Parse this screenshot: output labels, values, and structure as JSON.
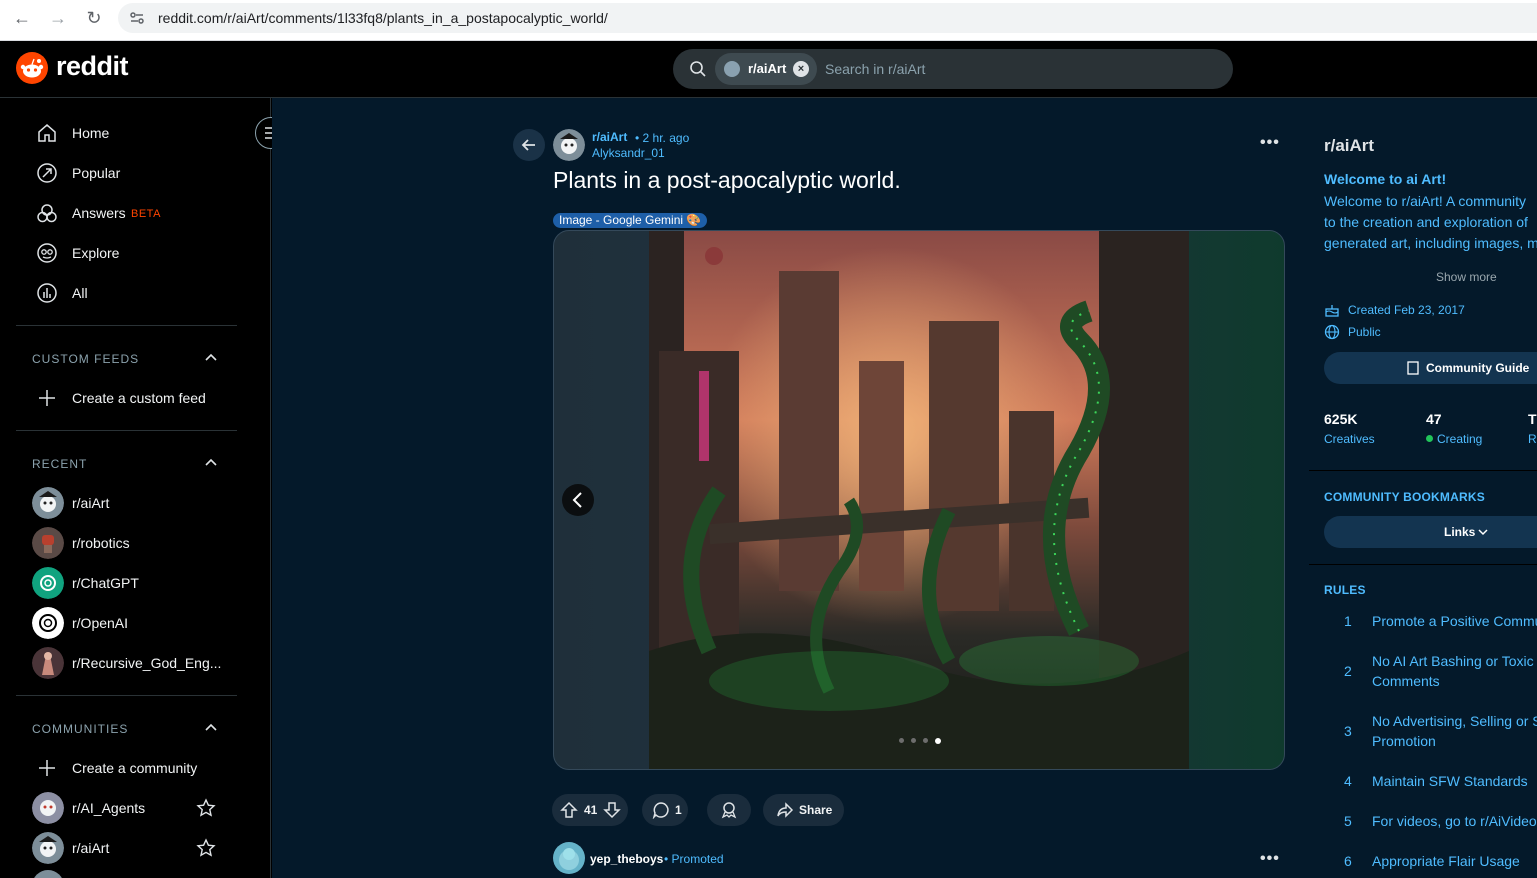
{
  "browser": {
    "url": "reddit.com/r/aiArt/comments/1l33fq8/plants_in_a_postapocalyptic_world/"
  },
  "header": {
    "logo_text": "reddit",
    "search_chip": "r/aiArt",
    "search_placeholder": "Search in r/aiArt"
  },
  "sidebar": {
    "nav": [
      {
        "label": "Home",
        "icon": "home-icon"
      },
      {
        "label": "Popular",
        "icon": "popular-icon"
      },
      {
        "label": "Answers",
        "icon": "answers-icon",
        "badge": "BETA"
      },
      {
        "label": "Explore",
        "icon": "explore-icon"
      },
      {
        "label": "All",
        "icon": "all-icon"
      }
    ],
    "custom_feeds_header": "CUSTOM FEEDS",
    "create_custom_feed": "Create a custom feed",
    "recent_header": "RECENT",
    "recent": [
      "r/aiArt",
      "r/robotics",
      "r/ChatGPT",
      "r/OpenAI",
      "r/Recursive_God_Eng..."
    ],
    "communities_header": "COMMUNITIES",
    "create_community": "Create a community",
    "communities": [
      "r/AI_Agents",
      "r/aiArt"
    ]
  },
  "post": {
    "subreddit": "r/aiArt",
    "time": "• 2 hr. ago",
    "author": "Alyksandr_01",
    "title": "Plants in a post-apocalyptic world.",
    "flair": "Image - Google Gemini 🎨",
    "gallery_total": 4,
    "gallery_active_index": 3,
    "votes": "41",
    "comments": "1",
    "share_label": "Share"
  },
  "promoted": {
    "user": "yep_theboys",
    "tag": "• Promoted"
  },
  "community": {
    "name": "r/aiArt",
    "welcome": "Welcome to ai Art!",
    "description_lines": [
      "Welcome to r/aiArt! A community",
      "to the creation and exploration of",
      "generated art, including images, m"
    ],
    "show_more": "Show more",
    "created": "Created Feb 23, 2017",
    "visibility": "Public",
    "guide_button": "Community Guide",
    "stats": [
      {
        "value": "625K",
        "label": "Creatives"
      },
      {
        "value": "47",
        "label": "Creating"
      },
      {
        "value": "T",
        "label": "R"
      }
    ],
    "bookmarks_header": "COMMUNITY BOOKMARKS",
    "links_button": "Links",
    "rules_header": "RULES",
    "rules": [
      {
        "n": "1",
        "lines": [
          "Promote a Positive Commu"
        ]
      },
      {
        "n": "2",
        "lines": [
          "No AI Art Bashing or Toxic",
          "Comments"
        ]
      },
      {
        "n": "3",
        "lines": [
          "No Advertising, Selling or S",
          "Promotion"
        ]
      },
      {
        "n": "4",
        "lines": [
          "Maintain SFW Standards"
        ]
      },
      {
        "n": "5",
        "lines": [
          "For videos, go to r/AiVideo"
        ]
      },
      {
        "n": "6",
        "lines": [
          "Appropriate Flair Usage"
        ]
      }
    ]
  },
  "colors": {
    "accent_link": "#4fbcff",
    "brand": "#ff4500",
    "main_bg": "#04192a"
  }
}
